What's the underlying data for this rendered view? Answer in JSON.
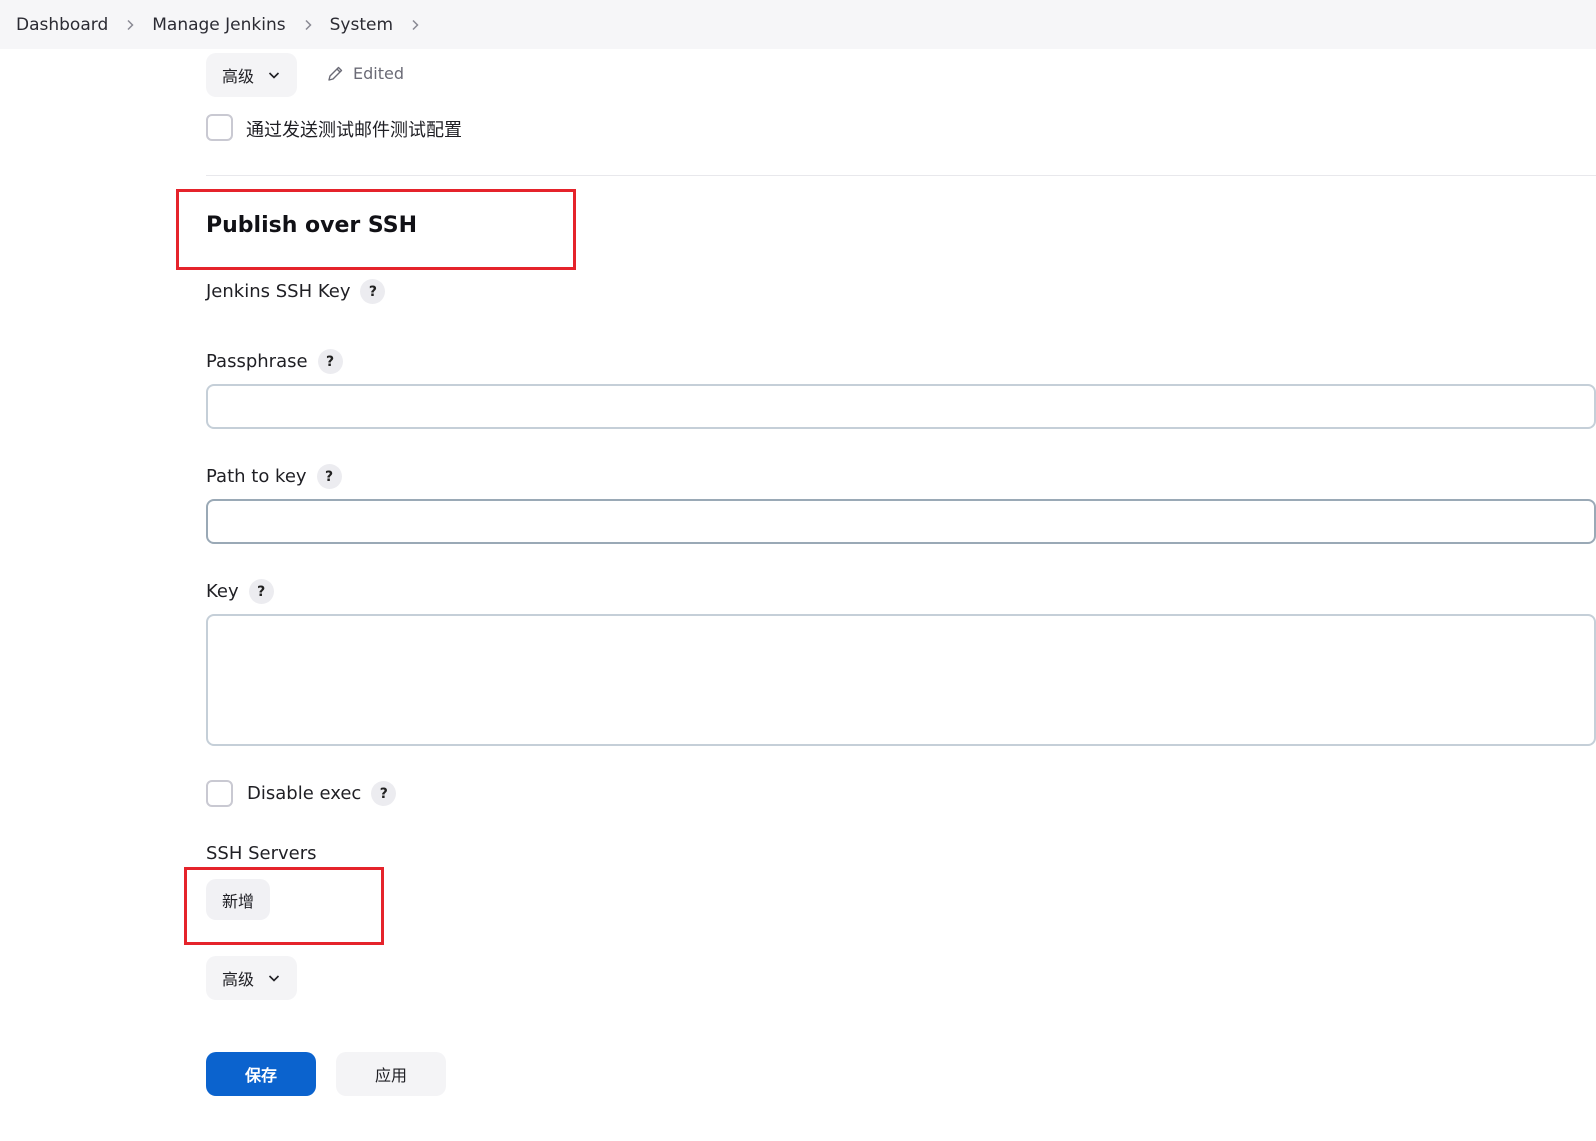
{
  "breadcrumb": {
    "items": [
      {
        "label": "Dashboard"
      },
      {
        "label": "Manage Jenkins"
      },
      {
        "label": "System"
      }
    ]
  },
  "top": {
    "advanced_label": "高级",
    "edited_label": "Edited",
    "test_config_label": "通过发送测试邮件测试配置"
  },
  "ssh": {
    "title": "Publish over SSH",
    "jenkins_ssh_key_label": "Jenkins SSH Key",
    "passphrase_label": "Passphrase",
    "passphrase_value": "",
    "path_to_key_label": "Path to key",
    "path_to_key_value": "",
    "key_label": "Key",
    "key_value": "",
    "disable_exec_label": "Disable exec",
    "ssh_servers_label": "SSH Servers",
    "add_label": "新增",
    "advanced_label": "高级",
    "help_glyph": "?"
  },
  "footer": {
    "save_label": "保存",
    "apply_label": "应用"
  },
  "colors": {
    "primary": "#0b63ce",
    "highlight": "#e5232b"
  }
}
